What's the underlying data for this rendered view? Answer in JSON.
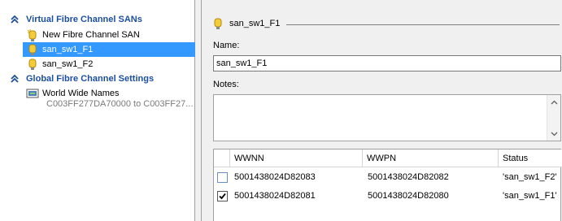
{
  "tree": {
    "section_sans": "Virtual Fibre Channel SANs",
    "items": [
      {
        "label": "New Fibre Channel SAN"
      },
      {
        "label": "san_sw1_F1"
      },
      {
        "label": "san_sw1_F2"
      }
    ],
    "section_global": "Global Fibre Channel Settings",
    "wwn": {
      "label": "World Wide Names",
      "range": "C003FF277DA70000 to C003FF27..."
    }
  },
  "detail": {
    "title": "san_sw1_F1",
    "name_label": "Name:",
    "name_value": "san_sw1_F1",
    "notes_label": "Notes:",
    "notes_value": "",
    "columns": {
      "wwnn": "WWNN",
      "wwpn": "WWPN",
      "status": "Status"
    },
    "rows": [
      {
        "checked": false,
        "wwnn": "5001438024D82083",
        "wwpn": "5001438024D82082",
        "status": "'san_sw1_F2'"
      },
      {
        "checked": true,
        "wwnn": "5001438024D82081",
        "wwpn": "5001438024D82080",
        "status": "'san_sw1_F1'"
      }
    ]
  },
  "colors": {
    "accent": "#1c4e9e",
    "selection": "#3399ff"
  }
}
